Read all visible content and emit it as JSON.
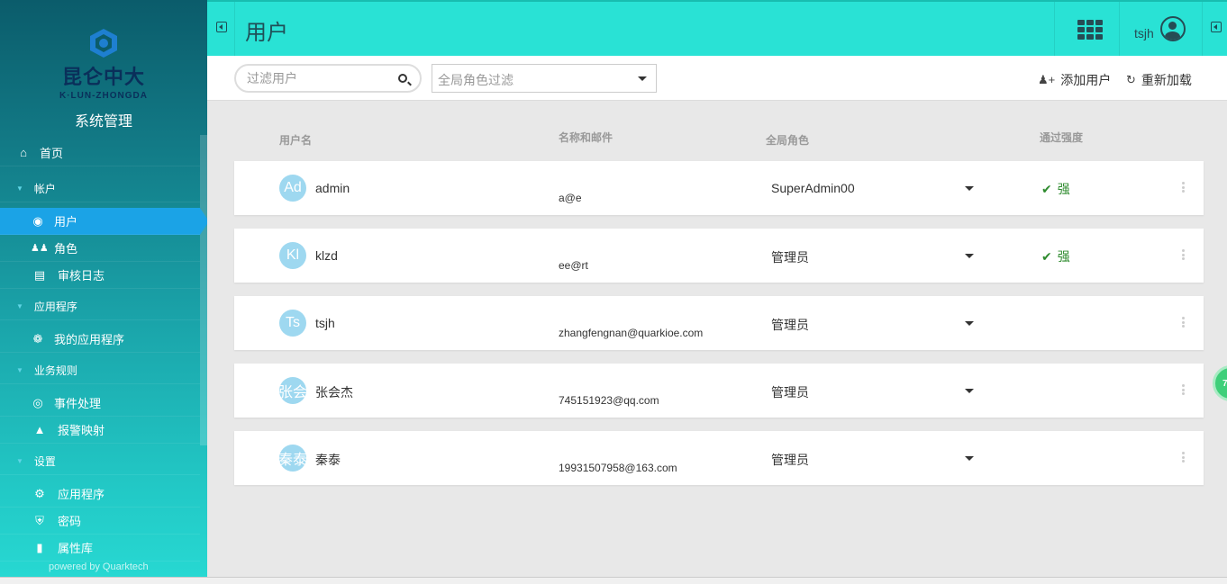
{
  "sidebar": {
    "logo_text": "昆仑中大",
    "logo_sub": "K·LUN-ZHONGDA",
    "title": "系统管理",
    "items": [
      {
        "label": "首页",
        "icon": "home-icon",
        "type": "item"
      },
      {
        "label": "帐户",
        "type": "group"
      },
      {
        "label": "用户",
        "icon": "user-circle-icon",
        "type": "item",
        "active": true
      },
      {
        "label": "角色",
        "icon": "users-icon",
        "type": "item"
      },
      {
        "label": "审核日志",
        "icon": "log-icon",
        "type": "item"
      },
      {
        "label": "应用程序",
        "type": "group"
      },
      {
        "label": "我的应用程序",
        "icon": "cubes-icon",
        "type": "item"
      },
      {
        "label": "业务规则",
        "type": "group"
      },
      {
        "label": "事件处理",
        "icon": "broadcast-icon",
        "type": "item"
      },
      {
        "label": "报警映射",
        "icon": "bell-icon",
        "type": "item"
      },
      {
        "label": "设置",
        "type": "group"
      },
      {
        "label": "应用程序",
        "icon": "gear-icon",
        "type": "item"
      },
      {
        "label": "密码",
        "icon": "shield-icon",
        "type": "item"
      },
      {
        "label": "属性库",
        "icon": "book-icon",
        "type": "item"
      }
    ],
    "powered_by": "powered by Quarktech"
  },
  "header": {
    "title": "用户",
    "username": "tsjh"
  },
  "toolbar": {
    "search_placeholder": "过滤用户",
    "role_filter_placeholder": "全局角色过滤",
    "add_user_label": "添加用户",
    "reload_label": "重新加载"
  },
  "table": {
    "headers": {
      "username": "用户名",
      "name_email": "名称和邮件",
      "global_role": "全局角色",
      "password_strength": "通过强度"
    },
    "rows": [
      {
        "initials": "Ad",
        "username": "admin",
        "email": "a@e",
        "role": "SuperAdmin00",
        "strength": "强"
      },
      {
        "initials": "Kl",
        "username": "klzd",
        "email": "ee@rt",
        "role": "管理员",
        "strength": "强"
      },
      {
        "initials": "Ts",
        "username": "tsjh",
        "email": "zhangfengnan@quarkioe.com",
        "role": "管理员",
        "strength": ""
      },
      {
        "initials": "张会",
        "username": "张会杰",
        "email": "745151923@qq.com",
        "role": "管理员",
        "strength": ""
      },
      {
        "initials": "秦泰",
        "username": "秦泰",
        "email": "19931507958@163.com",
        "role": "管理员",
        "strength": ""
      }
    ]
  },
  "floating_badge": "74",
  "colors": {
    "topbar": "#29e2d5",
    "active_nav": "#1ba3e6",
    "avatar": "#9ed8f0",
    "strong": "#2e8b2e"
  }
}
